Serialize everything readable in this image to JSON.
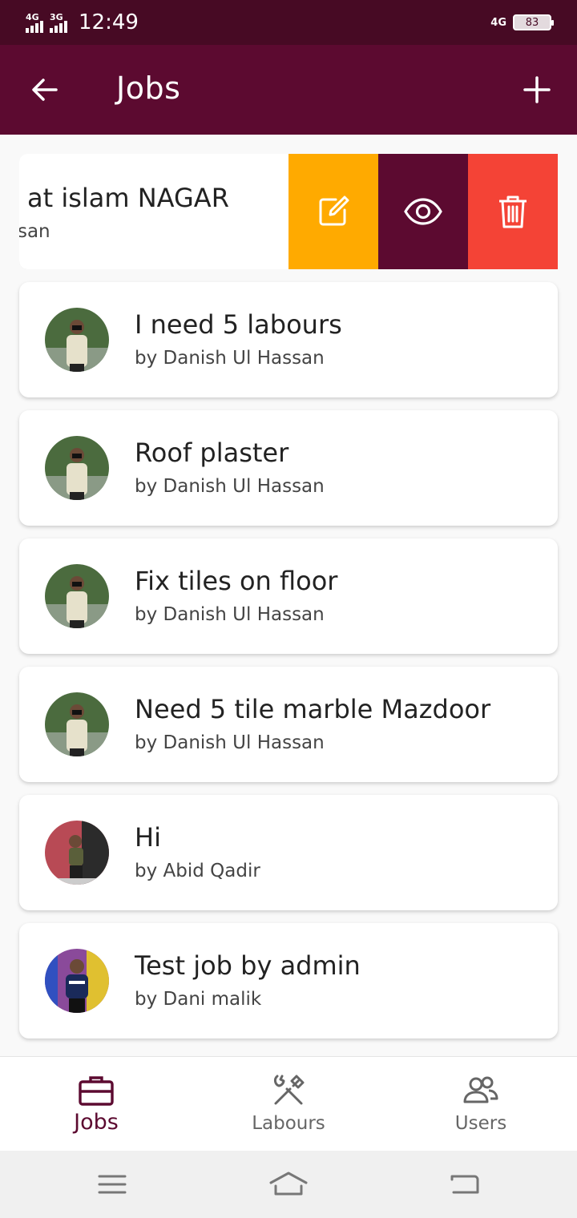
{
  "status_bar": {
    "signal1": "4G",
    "signal2": "3G",
    "time": "12:49",
    "network": "4G",
    "battery": "83"
  },
  "app_bar": {
    "title": "Jobs",
    "back_icon": "arrow-left-icon",
    "add_icon": "plus-icon"
  },
  "swiped_job": {
    "title_partial": "at islam NAGAR",
    "by_partial": "ssan",
    "actions": [
      {
        "name": "edit",
        "icon": "edit-icon",
        "color": "#ffaa00"
      },
      {
        "name": "view",
        "icon": "eye-icon",
        "color": "#5c0a30"
      },
      {
        "name": "delete",
        "icon": "trash-icon",
        "color": "#f44336"
      }
    ]
  },
  "jobs": [
    {
      "title": "I need 5 labours",
      "by": "by Danish Ul Hassan"
    },
    {
      "title": "Roof plaster",
      "by": "by Danish Ul Hassan"
    },
    {
      "title": "Fix tiles on floor",
      "by": "by Danish Ul Hassan"
    },
    {
      "title": "Need 5 tile marble Mazdoor",
      "by": "by Danish Ul Hassan"
    },
    {
      "title": "Hi",
      "by": "by Abid Qadir"
    },
    {
      "title": "Test job by admin",
      "by": "by Dani malik"
    }
  ],
  "bottom_nav": [
    {
      "label": "Jobs",
      "icon": "briefcase-icon",
      "active": true
    },
    {
      "label": "Labours",
      "icon": "tools-icon",
      "active": false
    },
    {
      "label": "Users",
      "icon": "users-icon",
      "active": false
    }
  ],
  "colors": {
    "primary": "#5c0a30",
    "status_bar": "#470a24",
    "edit": "#ffaa00",
    "delete": "#f44336"
  }
}
